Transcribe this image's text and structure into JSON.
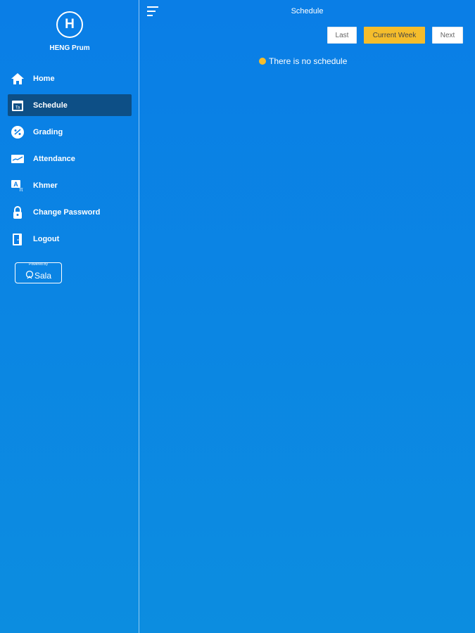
{
  "user": {
    "initial": "H",
    "name": "HENG Prum"
  },
  "sidebar": {
    "items": [
      {
        "label": "Home",
        "icon": "home-icon",
        "active": false
      },
      {
        "label": "Schedule",
        "icon": "calendar-icon",
        "active": true
      },
      {
        "label": "Grading",
        "icon": "grading-icon",
        "active": false
      },
      {
        "label": "Attendance",
        "icon": "attendance-icon",
        "active": false
      },
      {
        "label": "Khmer",
        "icon": "language-icon",
        "active": false
      },
      {
        "label": "Change Password",
        "icon": "lock-icon",
        "active": false
      },
      {
        "label": "Logout",
        "icon": "logout-icon",
        "active": false
      }
    ],
    "powered_by": {
      "caption": "Powered By",
      "brand": "Sala"
    }
  },
  "header": {
    "title": "Schedule"
  },
  "week_nav": {
    "last": "Last",
    "current": "Current Week",
    "next": "Next"
  },
  "content": {
    "empty_message": "There is no schedule"
  },
  "colors": {
    "background": "#0a7ee6",
    "active_item": "#0d4f86",
    "accent": "#f5bd2c"
  }
}
